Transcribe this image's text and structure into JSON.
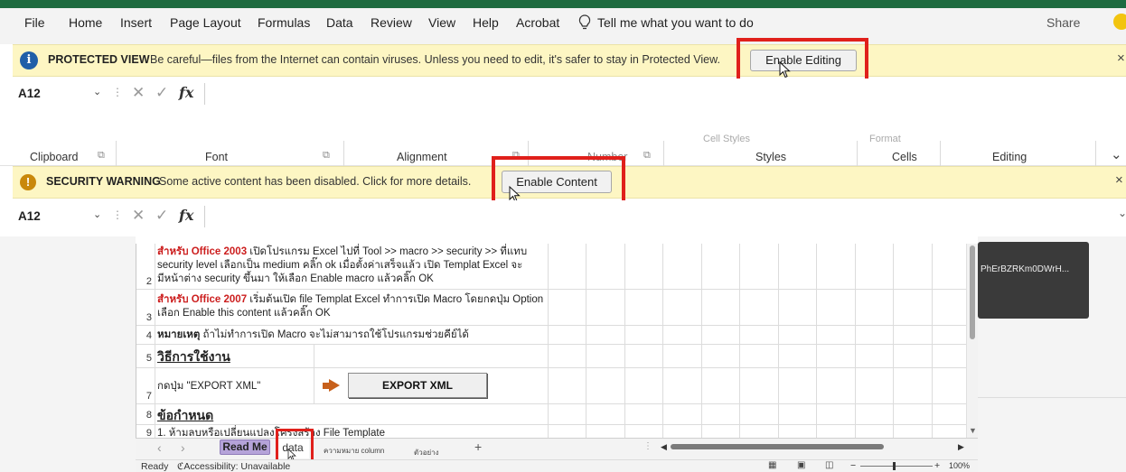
{
  "menu": {
    "items": [
      "File",
      "Home",
      "Insert",
      "Page Layout",
      "Formulas",
      "Data",
      "Review",
      "View",
      "Help",
      "Acrobat"
    ],
    "tell_me": "Tell me what you want to do",
    "share": "Share"
  },
  "protected_view": {
    "title": "PROTECTED VIEW",
    "message": "Be careful—files from the Internet can contain viruses. Unless you need to edit, it's safer to stay in Protected View.",
    "button": "Enable Editing",
    "close": "×"
  },
  "formula_bar_1": {
    "name_box": "A12",
    "cancel": "✕",
    "enter": "✓",
    "fx": "fx"
  },
  "ribbon": {
    "groups": [
      "Clipboard",
      "Font",
      "Alignment",
      "Number",
      "Styles",
      "Cells",
      "Editing"
    ],
    "faded_top": [
      "Cell Styles",
      "Format"
    ]
  },
  "security_warning": {
    "title": "SECURITY WARNING",
    "message": "Some active content has been disabled. Click for more details.",
    "button": "Enable Content",
    "close": "×"
  },
  "formula_bar_2": {
    "name_box": "A12",
    "cancel": "✕",
    "enter": "✓",
    "fx": "fx"
  },
  "sheet": {
    "rows": [
      {
        "num": "2",
        "bold_red": "สำหรับ Office 2003",
        "text": " เปิดโปรแกรม Excel ไปที่ Tool >> macro >> security >> ที่แทบ security level เลือกเป็น medium คลิ๊ก ok เมื่อตั้งค่าเสร็จแล้ว เปิด Templat Excel จะมีหน้าต่าง  security ขึ้นมา ให้เลือก Enable macro แล้วคลิ๊ก OK"
      },
      {
        "num": "3",
        "bold_red": "สำหรับ Office 2007",
        "text": " เริ่มต้นเปิด file Templat Excel ทำการเปิด Macro โดยกดปุ่ม Option เลือก Enable this content แล้วคลิ๊ก OK"
      },
      {
        "num": "4",
        "bold": "หมายเหตุ",
        "text": "  ถ้าไม่ทำการเปิด Macro จะไม่สามารถใช้โปรแกรมช่วยคีย์ได้"
      },
      {
        "num": "5",
        "heading": "วิธีการใช้งาน"
      },
      {
        "num": "7",
        "text": "กดปุ่ม \"EXPORT XML\""
      },
      {
        "num": "8",
        "heading": "ข้อกำหนด"
      },
      {
        "num": "9",
        "text": "1.  ห้ามลบหรือเปลี่ยนแปลงโครงสร้าง File Template"
      }
    ],
    "export_button": "EXPORT XML",
    "side_tile": "PhErBZRKm0DWrH...",
    "tabs": [
      "Read Me",
      "data",
      "ความหมาย column",
      "ตัวอย่าง"
    ],
    "add_tab": "+",
    "nav_prev": "‹",
    "nav_next": "›"
  },
  "status": {
    "ready": "Ready",
    "accessibility": "Accessibility: Unavailable",
    "zoom_minus": "−",
    "zoom_plus": "+",
    "zoom": "100%"
  },
  "colors": {
    "highlight_box": "#e0201b",
    "message_bar": "#fdf6c3",
    "excel_green": "#1e6b40",
    "readme_tab": "#b5a3d9"
  }
}
